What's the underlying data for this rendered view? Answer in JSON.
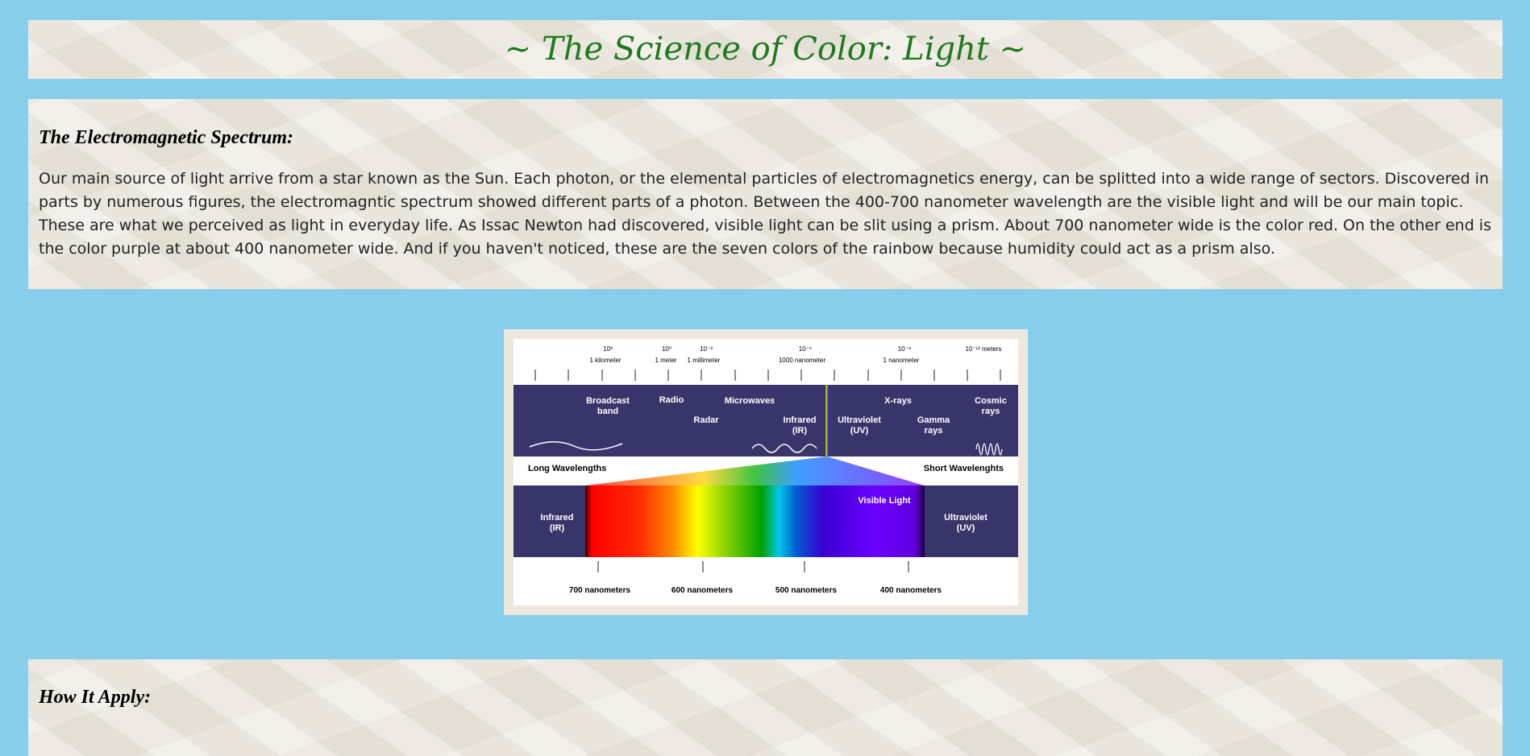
{
  "header": {
    "title": "~ The Science of Color: Light ~"
  },
  "spectrum_section": {
    "heading": "The Electromagnetic Spectrum:",
    "body": "Our main source of light arrive from a star known as the Sun. Each photon, or the elemental particles of electromagnetics energy, can be splitted into a wide range of sectors. Discovered in parts by numerous figures, the electromagntic spectrum showed different parts of a photon. Between the 400-700 nanometer wavelength are the visible light and will be our main topic. These are what we perceived as light in everyday life. As Issac Newton had discovered, visible light can be slit using a prism. About 700 nanometer wide is the color red. On the other end is the color purple at about 400 nanometer wide. And if you haven't noticed, these are the seven colors of the rainbow because humidity could act as a prism also."
  },
  "figure": {
    "scale_labels": [
      {
        "exp": "10³",
        "name": "1 kilometer"
      },
      {
        "exp": "10⁰",
        "name": "1 meter"
      },
      {
        "exp": "10⁻³",
        "name": "1 millimeter"
      },
      {
        "exp": "10⁻⁶",
        "name": "1000 nanometer"
      },
      {
        "exp": "10⁻⁹",
        "name": "1 nanometer"
      },
      {
        "exp": "10⁻¹² meters",
        "name": ""
      }
    ],
    "bands": {
      "broadcast_1": "Broadcast",
      "broadcast_2": "band",
      "radio": "Radio",
      "microwaves": "Microwaves",
      "radar": "Radar",
      "infrared_1": "Infrared",
      "infrared_2": "(IR)",
      "ultraviolet_1": "Ultraviolet",
      "ultraviolet_2": "(UV)",
      "xrays": "X-rays",
      "gamma_1": "Gamma",
      "gamma_2": "rays",
      "cosmic_1": "Cosmic",
      "cosmic_2": "rays"
    },
    "long_wavelengths": "Long Wavelengths",
    "short_wavelengths": "Short Wavelenghts",
    "visible_light": "Visible Light",
    "nanometer_labels": [
      "700 nanometers",
      "600 nanometers",
      "500 nanometers",
      "400 nanometers"
    ],
    "colors": {
      "band_bg": "#38356b"
    }
  },
  "apply_section": {
    "heading": "How It Apply:"
  }
}
